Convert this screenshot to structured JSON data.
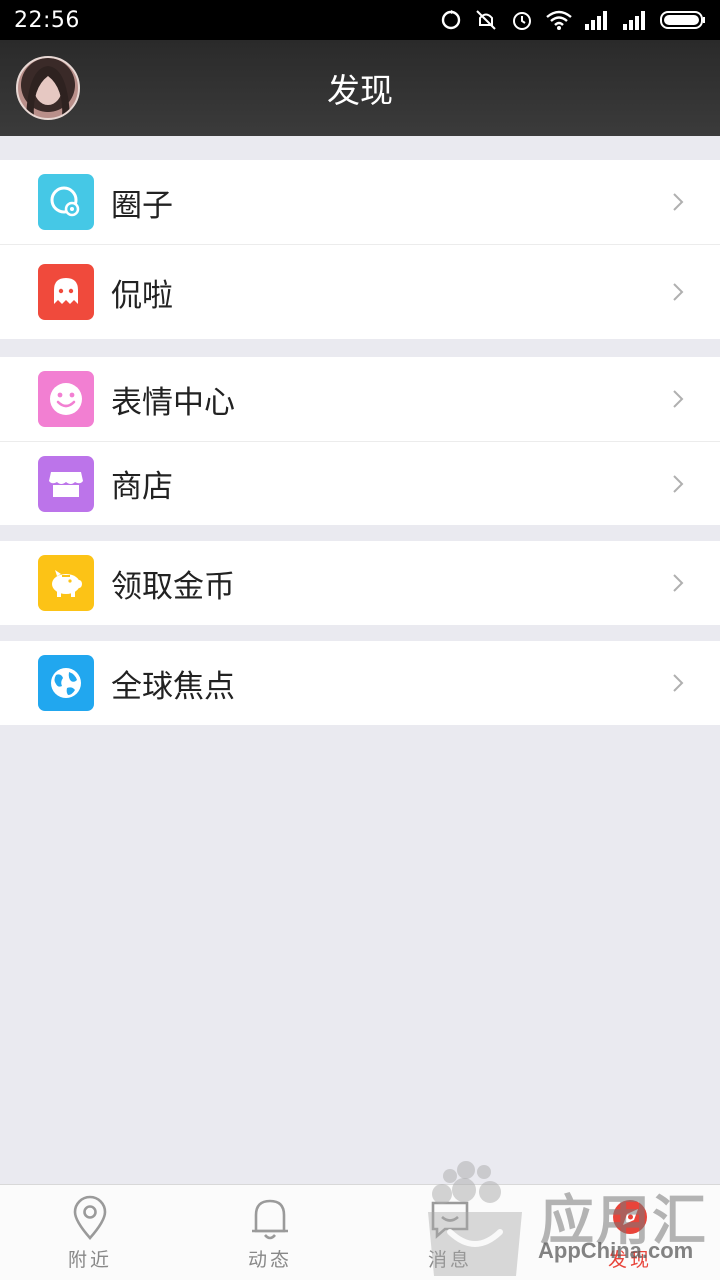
{
  "status_bar": {
    "time": "22:56",
    "icons": [
      "sync-icon",
      "mute-icon",
      "alarm-icon",
      "wifi-icon",
      "signal-icon",
      "signal-icon",
      "battery-icon"
    ]
  },
  "header": {
    "title": "发现",
    "avatar_icon": "user-avatar"
  },
  "groups": [
    {
      "items": [
        {
          "label": "圈子",
          "icon": "circle-location-icon",
          "color": "#45c8e6"
        },
        {
          "label": "侃啦",
          "icon": "ghost-chat-icon",
          "color": "#f04a3c"
        }
      ]
    },
    {
      "items": [
        {
          "label": "表情中心",
          "icon": "smiley-icon",
          "color": "#f27fd2"
        },
        {
          "label": "商店",
          "icon": "store-icon",
          "color": "#bc74ea"
        }
      ]
    },
    {
      "items": [
        {
          "label": "领取金币",
          "icon": "piggy-bank-icon",
          "color": "#fcc316"
        }
      ]
    },
    {
      "items": [
        {
          "label": "全球焦点",
          "icon": "globe-icon",
          "color": "#21a7ef"
        }
      ]
    }
  ],
  "bottom_nav": {
    "items": [
      {
        "label": "附近",
        "icon": "location-pin-icon",
        "active": false
      },
      {
        "label": "动态",
        "icon": "bell-icon",
        "active": false
      },
      {
        "label": "消息",
        "icon": "chat-bubble-icon",
        "active": false
      },
      {
        "label": "发现",
        "icon": "compass-icon",
        "active": true
      }
    ],
    "active_color": "#e8443a"
  },
  "watermark": {
    "text": "应用汇",
    "sub": "AppChina.com"
  }
}
